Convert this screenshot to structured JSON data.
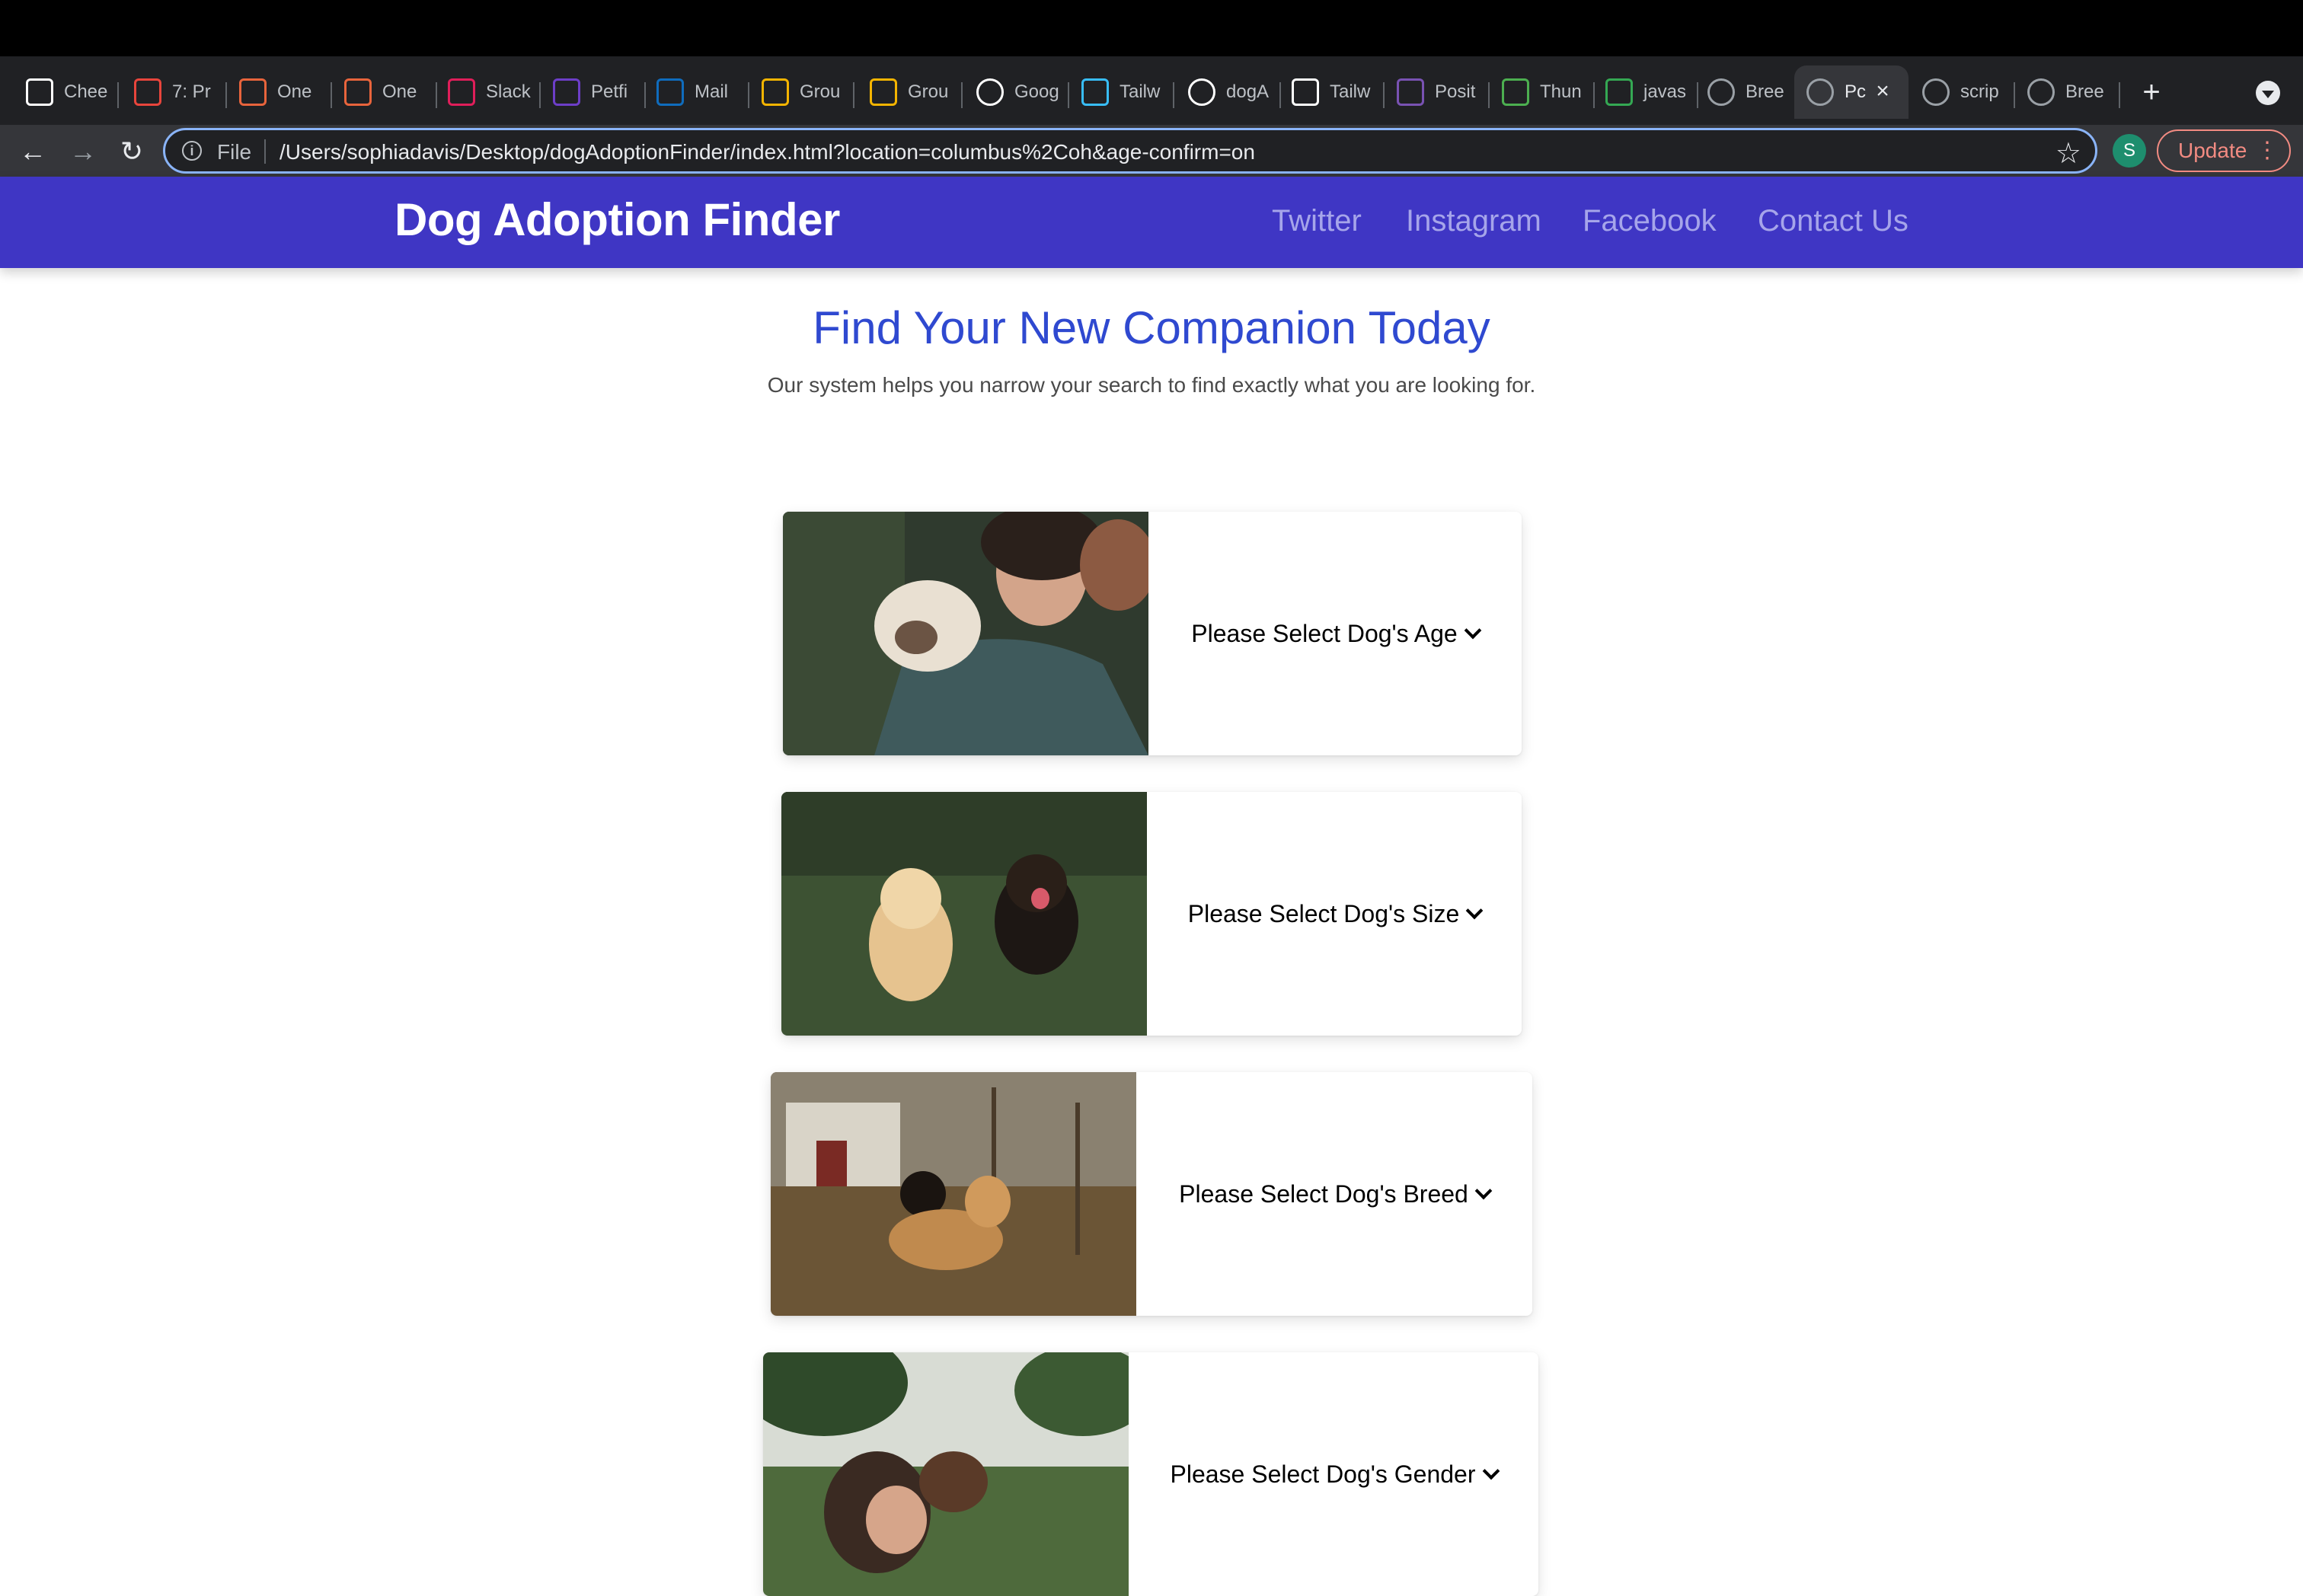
{
  "browser": {
    "tabs": [
      {
        "label": "Chee",
        "icon": "cheerio-icon",
        "color": "#ffffff"
      },
      {
        "label": "7: Pr",
        "icon": "settings-gear-icon",
        "color": "#e8453c"
      },
      {
        "label": "One",
        "icon": "helmet-icon",
        "color": "#e8643c"
      },
      {
        "label": "One",
        "icon": "helmet-icon",
        "color": "#e8643c"
      },
      {
        "label": "Slack",
        "icon": "slack-icon",
        "color": "#e01e5a"
      },
      {
        "label": "Petfi",
        "icon": "petfinder-icon",
        "color": "#6d3ec8"
      },
      {
        "label": "Mail",
        "icon": "outlook-mail-icon",
        "color": "#0f6cbd"
      },
      {
        "label": "Grou",
        "icon": "slides-icon",
        "color": "#f4b400"
      },
      {
        "label": "Grou",
        "icon": "slides-icon",
        "color": "#f4b400"
      },
      {
        "label": "Goog",
        "icon": "google-icon",
        "color": "#ffffff"
      },
      {
        "label": "Tailw",
        "icon": "tailwind-icon",
        "color": "#38bdf8"
      },
      {
        "label": "dogA",
        "icon": "github-icon",
        "color": "#ffffff"
      },
      {
        "label": "Tailw",
        "icon": "codepen-icon",
        "color": "#ffffff"
      },
      {
        "label": "Posit",
        "icon": "bootstrap-icon",
        "color": "#7952b3"
      },
      {
        "label": "Thun",
        "icon": "px-icon",
        "color": "#4caf50"
      },
      {
        "label": "javas",
        "icon": "sparkle-icon",
        "color": "#34a853"
      },
      {
        "label": "Bree",
        "icon": "globe-icon",
        "color": "#9aa0a6"
      },
      {
        "label": "Pc",
        "icon": "globe-icon",
        "color": "#9aa0a6",
        "active": true
      },
      {
        "label": "scrip",
        "icon": "globe-icon",
        "color": "#9aa0a6"
      },
      {
        "label": "Bree",
        "icon": "globe-icon",
        "color": "#9aa0a6"
      }
    ],
    "new_tab": "+",
    "address": {
      "scheme_label": "File",
      "url": "/Users/sophiadavis/Desktop/dogAdoptionFinder/index.html?location=columbus%2Coh&age-confirm=on"
    },
    "profile_initial": "S",
    "update_label": "Update"
  },
  "site": {
    "title": "Dog Adoption Finder",
    "nav": [
      "Twitter",
      "Instagram",
      "Facebook",
      "Contact Us"
    ],
    "hero_title": "Find Your New Companion Today",
    "hero_subtitle": "Our system helps you narrow your search to find exactly what you are looking for.",
    "selects": [
      {
        "label": "Please Select Dog's Age",
        "photo": "woman-hugging-shih-tzu-photo"
      },
      {
        "label": "Please Select Dog's Size",
        "photo": "two-dogs-on-grass-photo"
      },
      {
        "label": "Please Select Dog's Breed",
        "photo": "dogs-by-fence-photo"
      },
      {
        "label": "Please Select Dog's Gender",
        "photo": "woman-with-dog-outdoors-photo"
      }
    ]
  },
  "colors": {
    "header_bg": "#3f36c4",
    "nav_link": "#a6a5ea",
    "hero_title": "#2f49d0",
    "browser_focus": "#8ab4f8",
    "update_accent": "#f28b82"
  }
}
